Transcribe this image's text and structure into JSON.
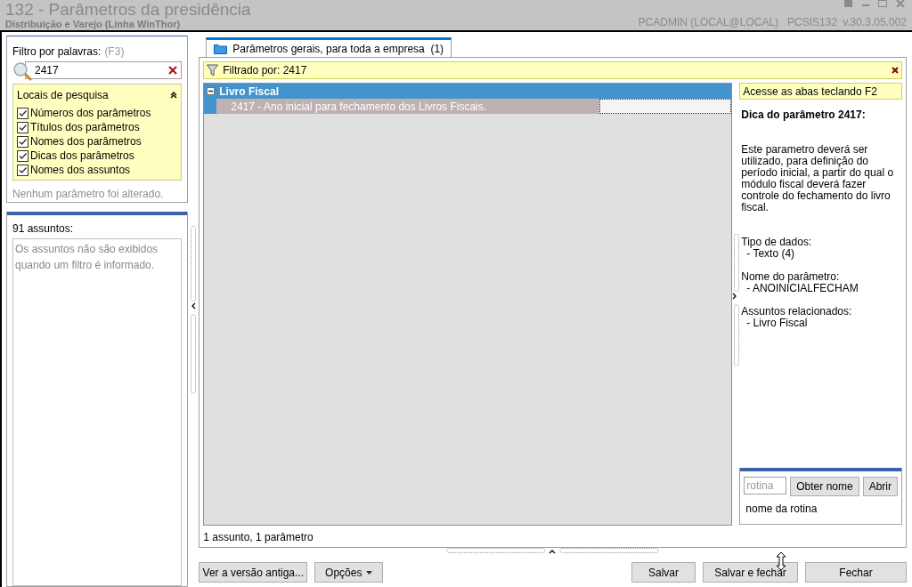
{
  "window": {
    "title": "132 - Parâmetros da presidência",
    "subtitle": "Distribuição e Varejo (Linha WinThor)",
    "user": "PCADMIN (LOCAL@LOCAL)",
    "module": "PCSIS132",
    "version": "v.30.3.05.002"
  },
  "filter": {
    "label": "Filtro por palavras:",
    "shortcut": "(F3)",
    "value": "2417",
    "search_places": {
      "title": "Locais de pesquisa",
      "expanded": true,
      "options": [
        {
          "label": "Números dos parâmetros",
          "checked": true
        },
        {
          "label": "Títulos dos parâmetros",
          "checked": true
        },
        {
          "label": "Nomes dos parâmetros",
          "checked": true
        },
        {
          "label": "Dicas dos parâmetros",
          "checked": true
        },
        {
          "label": "Nomes dos assuntos",
          "checked": true
        }
      ]
    },
    "status": "Nenhum parâmetro foi alterado."
  },
  "subjects": {
    "count_label": "91 assuntos:",
    "message": "Os assuntos não são exibidos quando um filtro é informado."
  },
  "tabs": [
    {
      "label": "Parâmetros gerais, para toda a empresa",
      "count": "(1)",
      "selected": true
    }
  ],
  "filter_bar": {
    "label": "Filtrado por: 2417"
  },
  "tree": [
    {
      "label": "Livro Fiscal",
      "expanded": true,
      "children": [
        {
          "label": "2417 - Ano inicial para fechamento dos Livros Fiscais.",
          "selected": true
        }
      ]
    }
  ],
  "summary": "1 assunto, 1 parâmetro",
  "help": {
    "hint": "Acesse as abas teclando F2",
    "title": "Dica do parâmetro 2417:",
    "description": "Este parametro deverá ser utilizado, para definição do período inicial, a partir do qual o módulo fiscal deverá fazer controle do fechamento do livro fiscal.",
    "sections": [
      {
        "heading": "Tipo de dados:",
        "value": "- Texto (4)"
      },
      {
        "heading": "Nome do parâmetro:",
        "value": "- ANOINICIALFECHAM"
      },
      {
        "heading": "Assuntos relacionados:",
        "value": "- Livro Fiscal"
      }
    ]
  },
  "routine": {
    "placeholder": "rotina",
    "buttons": [
      "Obter nome",
      "Abrir"
    ],
    "name_label": "nome da rotina"
  },
  "left_buttons": [
    {
      "label": "Ver a versão antiga...",
      "kind": "plain"
    },
    {
      "label": "Opções",
      "kind": "dropdown"
    }
  ],
  "right_buttons": [
    "Salvar",
    "Salvar e fechar",
    "Fechar"
  ]
}
